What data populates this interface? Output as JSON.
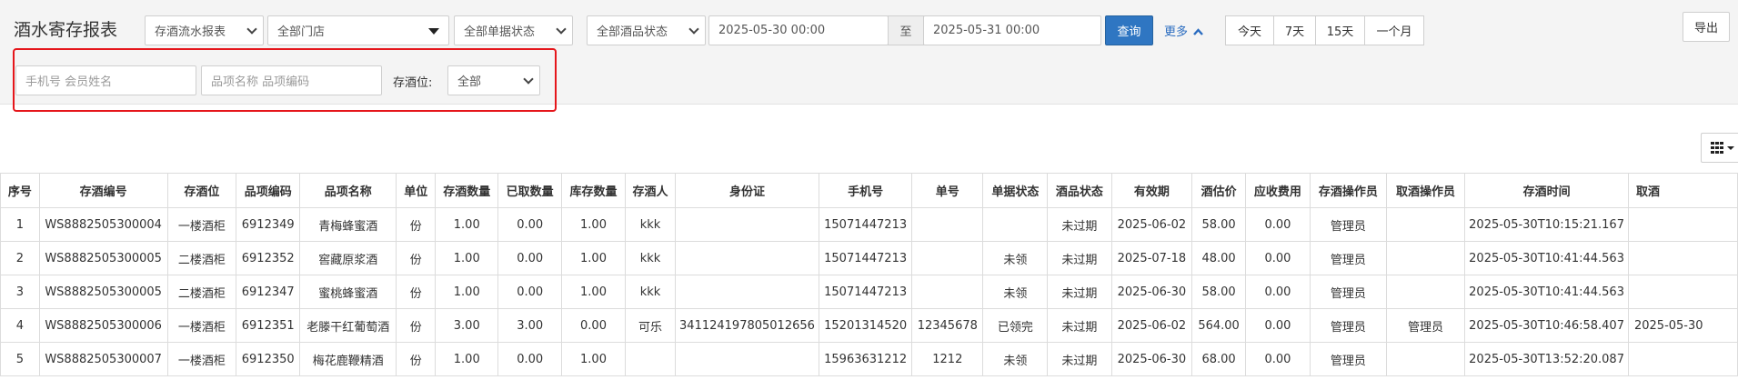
{
  "page": {
    "title": "酒水寄存报表"
  },
  "filters": {
    "report_type": "存酒流水报表",
    "store": "全部门店",
    "order_status": "全部单据状态",
    "wine_status": "全部酒品状态",
    "start_time": "2025-05-30 00:00",
    "range_sep": "至",
    "end_time": "2025-05-31 00:00",
    "search_label": "查询",
    "more_label": "更多",
    "quick_ranges": [
      "今天",
      "7天",
      "15天",
      "一个月"
    ],
    "export_label": "导出",
    "phone_placeholder": "手机号 会员姓名",
    "item_placeholder": "品项名称 品项编码",
    "storage_label": "存酒位:",
    "storage_value": "全部"
  },
  "table": {
    "columns": [
      "序号",
      "存酒编号",
      "存酒位",
      "品项编码",
      "品项名称",
      "单位",
      "存酒数量",
      "已取数量",
      "库存数量",
      "存酒人",
      "身份证",
      "手机号",
      "单号",
      "单据状态",
      "酒品状态",
      "有效期",
      "酒估价",
      "应收费用",
      "存酒操作员",
      "取酒操作员",
      "存酒时间",
      "取酒"
    ],
    "rows": [
      [
        "1",
        "WS8882505300004",
        "一楼酒柜",
        "6912349",
        "青梅蜂蜜酒",
        "份",
        "1.00",
        "0.00",
        "1.00",
        "kkk",
        "",
        "15071447213",
        "",
        "",
        "未过期",
        "2025-06-02",
        "58.00",
        "0.00",
        "管理员",
        "",
        "2025-05-30T10:15:21.167",
        ""
      ],
      [
        "2",
        "WS8882505300005",
        "二楼酒柜",
        "6912352",
        "窖藏原浆酒",
        "份",
        "1.00",
        "0.00",
        "1.00",
        "kkk",
        "",
        "15071447213",
        "",
        "未领",
        "未过期",
        "2025-07-18",
        "48.00",
        "0.00",
        "管理员",
        "",
        "2025-05-30T10:41:44.563",
        ""
      ],
      [
        "3",
        "WS8882505300005",
        "二楼酒柜",
        "6912347",
        "蜜桃蜂蜜酒",
        "份",
        "1.00",
        "0.00",
        "1.00",
        "kkk",
        "",
        "15071447213",
        "",
        "未领",
        "未过期",
        "2025-06-30",
        "58.00",
        "0.00",
        "管理员",
        "",
        "2025-05-30T10:41:44.563",
        ""
      ],
      [
        "4",
        "WS8882505300006",
        "一楼酒柜",
        "6912351",
        "老滕干红葡萄酒",
        "份",
        "3.00",
        "3.00",
        "0.00",
        "可乐",
        "341124197805012656",
        "15201314520",
        "12345678",
        "已领完",
        "未过期",
        "2025-06-02",
        "564.00",
        "0.00",
        "管理员",
        "管理员",
        "2025-05-30T10:46:58.407",
        "2025-05-30"
      ],
      [
        "5",
        "WS8882505300007",
        "一楼酒柜",
        "6912350",
        "梅花鹿鞭精酒",
        "份",
        "1.00",
        "0.00",
        "1.00",
        "",
        "",
        "15963631212",
        "1212",
        "未领",
        "未过期",
        "2025-06-30",
        "68.00",
        "0.00",
        "管理员",
        "",
        "2025-05-30T13:52:20.087",
        ""
      ]
    ]
  },
  "colors": {
    "primary": "#2f76c2",
    "highlight_border": "#e5161b"
  },
  "icons": {
    "more": "chevron-up-icon",
    "columns": "grid-icon"
  }
}
